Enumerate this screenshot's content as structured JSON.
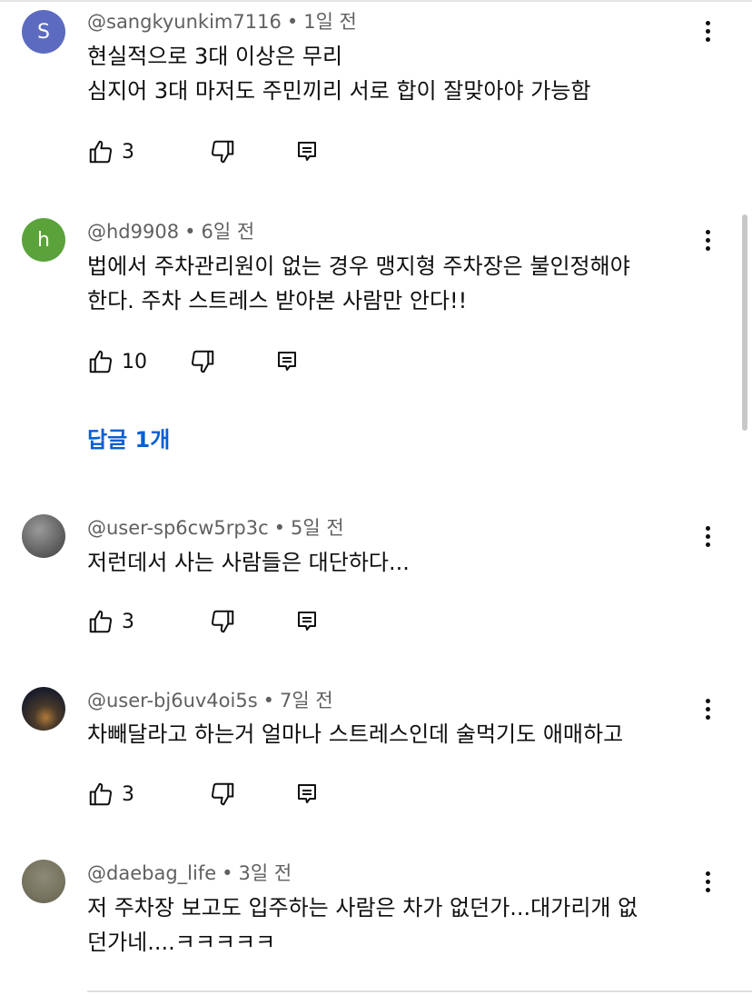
{
  "comments": [
    {
      "avatar_letter": "S",
      "avatar_color": "#5c6bc0",
      "username": "@sangkyunkim7116",
      "separator": "•",
      "time": "1일 전",
      "lines": [
        "현실적으로 3대 이상은 무리",
        "심지어 3대 마저도 주민끼리 서로 합이 잘맞아야 가능함"
      ],
      "likes": "3"
    },
    {
      "avatar_letter": "h",
      "avatar_color": "#5aa23a",
      "username": "@hd9908",
      "separator": "•",
      "time": "6일 전",
      "lines": [
        "법에서 주차관리원이 없는 경우 맹지형 주차장은 불인정해야",
        "한다. 주차 스트레스 받아본 사람만 안다!!"
      ],
      "likes": "10",
      "replies_label": "답글 1개"
    },
    {
      "avatar_letter": "",
      "avatar_color": "#6f6f6f",
      "username": "@user-sp6cw5rp3c",
      "separator": "•",
      "time": "5일 전",
      "lines": [
        "저런데서 사는 사람들은 대단하다..."
      ],
      "likes": "3"
    },
    {
      "avatar_letter": "",
      "avatar_color": "#2b2b35",
      "username": "@user-bj6uv4oi5s",
      "separator": "•",
      "time": "7일 전",
      "lines": [
        "차빼달라고 하는거 얼마나 스트레스인데 술먹기도 애매하고"
      ],
      "likes": "3"
    },
    {
      "avatar_letter": "",
      "avatar_color": "#7d7a67",
      "username": "@daebag_life",
      "separator": "•",
      "time": "3일 전",
      "lines": [
        "저 주차장 보고도 입주하는 사람은 차가 없던가...대가리개 없",
        "던가네....ㅋㅋㅋㅋㅋ"
      ]
    }
  ],
  "icons": {
    "like": "thumbs-up-icon",
    "dislike": "thumbs-down-icon",
    "reply": "reply-comment-icon",
    "more": "more-vertical-icon"
  }
}
